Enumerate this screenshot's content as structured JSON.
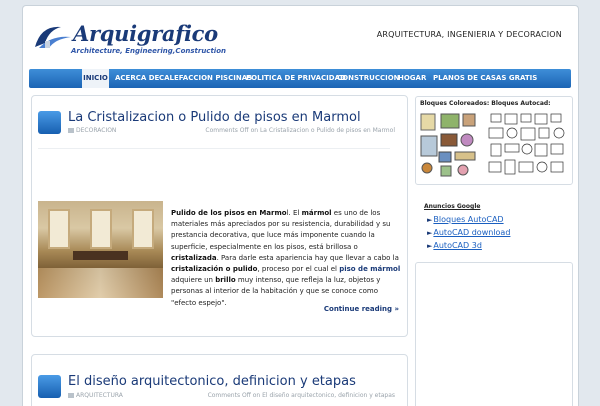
{
  "site": {
    "logo_text": "Arquigrafico",
    "logo_tagline": "Architecture, Engineering,Construction",
    "tagline": "ARQUITECTURA, INGENIERIA Y DECORACION"
  },
  "nav": {
    "items": [
      {
        "label": "INICIO",
        "active": true
      },
      {
        "label": "ACERCA DE"
      },
      {
        "label": "CALEFACCION PISCINAS"
      },
      {
        "label": "POLITICA DE PRIVACIDAD"
      },
      {
        "label": "CONSTRUCCION"
      },
      {
        "label": "HOGAR"
      },
      {
        "label": "PLANOS DE CASAS GRATIS"
      }
    ]
  },
  "posts": [
    {
      "title": "La Cristalizacion o Pulido de pisos en Marmol",
      "category": "DECORACION",
      "comments": "Comments Off on La Cristalizacion o Pulido de pisos en Marmol",
      "body": {
        "p1": "Pulido de los pisos en Marmo",
        "p2": "l. El ",
        "p3": "mármol",
        "p4": " es uno de los materiales más apreciados por su resistencia, durabilidad y su prestancia decorativa, que luce más imponente cuando la superficie, especialmente en los pisos, está brillosa o ",
        "p5": "cristalizada",
        "p6": ". Para darle esta apariencia hay que llevar a cabo la ",
        "p7": "cristalización o pulido",
        "p8": ", proceso por el cual el ",
        "p9": "piso de mármol",
        "p10": " adquiere un ",
        "p11": "brillo",
        "p12": " muy intenso, que refleja la luz, objetos y personas al interior de la habitación y que se conoce como \"efecto espejo\"."
      },
      "continue_label": "Continue reading »"
    },
    {
      "title": "El diseño arquitectonico, definicion y etapas",
      "category": "ARQUITECTURA",
      "comments": "Comments Off on El diseño arquitectonico, definicion y etapas"
    }
  ],
  "sidebar": {
    "blocks_title": "Bloques Coloreados: Bloques Autocad:",
    "ads_title": "Anuncios Google",
    "ad_links": [
      "Bloques AutoCAD",
      "AutoCAD download",
      "AutoCAD 3d"
    ],
    "arrow_glyph": "►"
  }
}
